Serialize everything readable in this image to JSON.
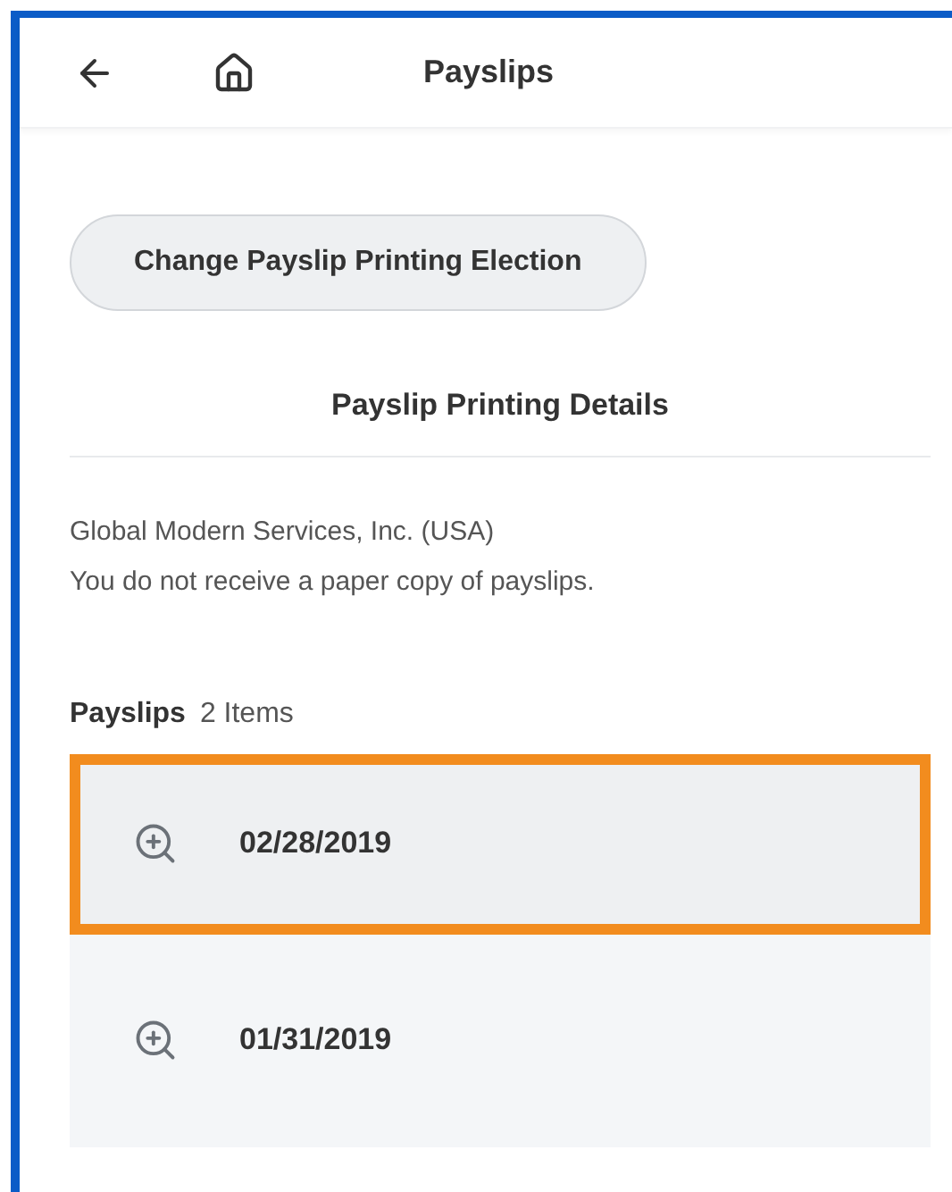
{
  "header": {
    "title": "Payslips"
  },
  "change_button": {
    "label": "Change Payslip Printing Election"
  },
  "details": {
    "heading": "Payslip Printing Details",
    "lines": [
      "Global Modern Services, Inc. (USA)",
      "You do not receive a paper copy of payslips."
    ]
  },
  "payslips": {
    "label": "Payslips",
    "count": "2 Items",
    "items": [
      {
        "date": "02/28/2019",
        "selected": true
      },
      {
        "date": "01/31/2019",
        "selected": false
      }
    ]
  }
}
